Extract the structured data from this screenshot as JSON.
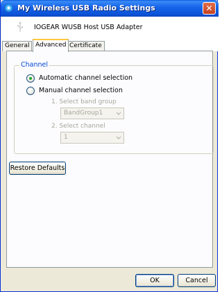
{
  "window": {
    "title": "My Wireless USB Radio Settings",
    "close_glyph": "✕"
  },
  "header": {
    "device_name": "IOGEAR WUSB Host USB Adapter",
    "icon": "usb-icon"
  },
  "tabs": [
    {
      "label": "General"
    },
    {
      "label": "Advanced"
    },
    {
      "label": "Certificate"
    }
  ],
  "channel": {
    "group_label": "Channel",
    "automatic_label": "Automatic channel selection",
    "manual_label": "Manual channel selection",
    "selected": "automatic",
    "band_group_label": "1. Select band group",
    "band_group_value": "BandGroup1",
    "channel_label": "2. Select channel",
    "channel_value": "1"
  },
  "buttons": {
    "restore_defaults": "Restore Defaults",
    "ok": "OK",
    "cancel": "Cancel"
  },
  "colors": {
    "titlebar": "#0a52d8",
    "group_label": "#0046d5",
    "disabled_text": "#a7a69a",
    "tab_highlight": "#ffc83c"
  }
}
